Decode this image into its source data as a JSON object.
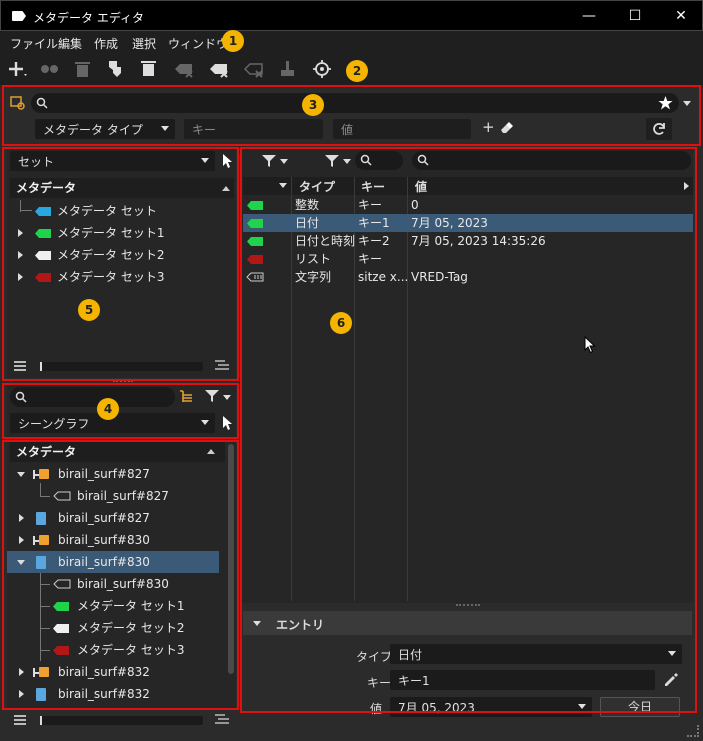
{
  "window": {
    "title": "メタデータ エディタ",
    "controls": [
      "—",
      "☐",
      "✕"
    ]
  },
  "menubar": {
    "items": [
      "ファイル",
      "編集",
      "作成",
      "選択",
      "ウィンドウ"
    ]
  },
  "badges": [
    "1",
    "2",
    "3",
    "4",
    "5",
    "6"
  ],
  "filterbar": {
    "search_value": "",
    "type_select": "メタデータ タイプ",
    "key_placeholder": "キー",
    "value_placeholder": "値",
    "add_symbol": "+"
  },
  "sets_panel": {
    "dropdown": "セット",
    "header": "メタデータ",
    "items": [
      "メタデータ セット",
      "メタデータ セット1",
      "メタデータ セット2",
      "メタデータ セット3"
    ]
  },
  "search_panel": {
    "search_value": "",
    "dropdown": "シーングラフ"
  },
  "scene_tree": {
    "header": "メタデータ",
    "items": [
      "birail_surf#827",
      "birail_surf#827",
      "birail_surf#827",
      "birail_surf#830",
      "birail_surf#830",
      "birail_surf#830",
      "メタデータ セット1",
      "メタデータ セット2",
      "メタデータ セット3",
      "birail_surf#832",
      "birail_surf#832"
    ]
  },
  "grid": {
    "columns": [
      "タイプ",
      "キー",
      "値"
    ],
    "rows": [
      {
        "type": "整数",
        "key": "キー",
        "value": "0"
      },
      {
        "type": "日付",
        "key": "キー1",
        "value": "7月 05, 2023"
      },
      {
        "type": "日付と時刻",
        "key": "キー2",
        "value": "7月 05, 2023 14:35:26"
      },
      {
        "type": "リスト",
        "key": "キー",
        "value": ""
      },
      {
        "type": "文字列",
        "key": "sitze x...",
        "value": "VRED-Tag"
      }
    ]
  },
  "entry": {
    "header": "エントリ",
    "type_label": "タイプ",
    "type_value": "日付",
    "key_label": "キー",
    "key_value": "キー1",
    "value_label": "値",
    "value_value": "7月 05, 2023",
    "today_button": "今日"
  },
  "colors": {
    "accent_blue": "#3a5a78",
    "badge": "#f4b400",
    "callout_red": "#e01010",
    "tag_green": "#1fd34a",
    "tag_blue": "#2aa7e0",
    "tag_white": "#f0f0f0",
    "tag_red": "#b01818"
  }
}
